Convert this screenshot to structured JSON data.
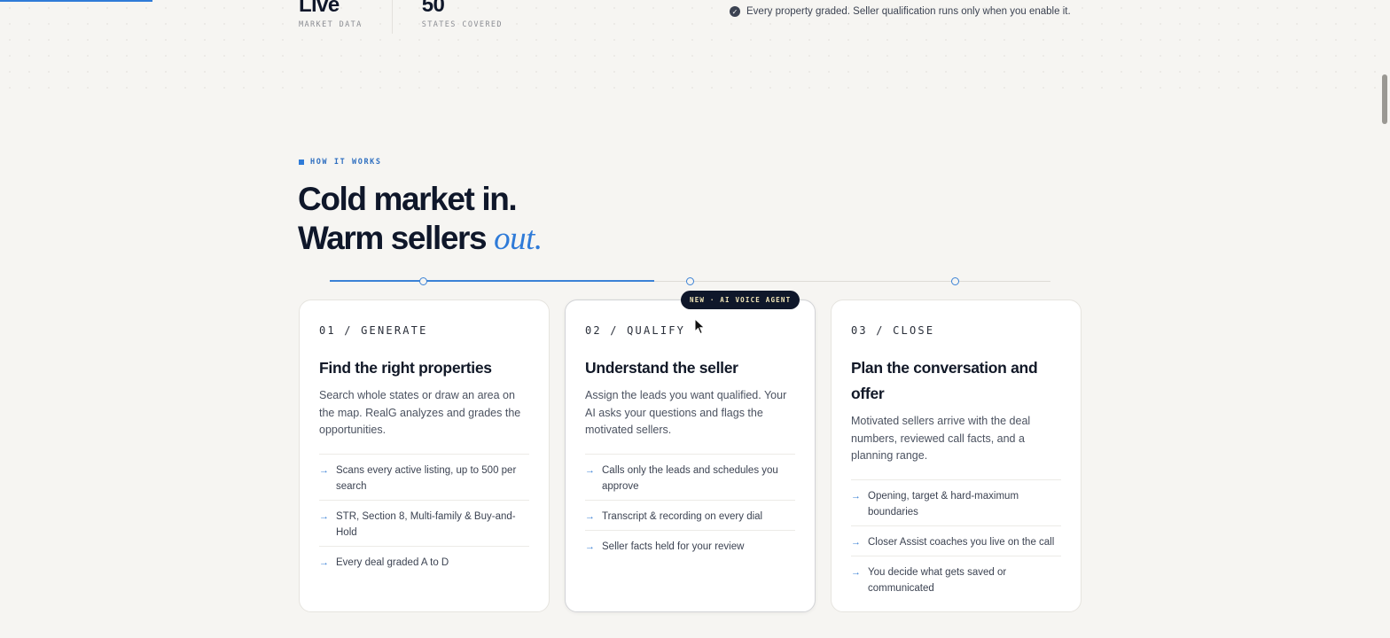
{
  "stats": [
    {
      "value": "Live",
      "label": "MARKET DATA"
    },
    {
      "value": "50",
      "label": "STATES COVERED"
    }
  ],
  "note": "Every property graded. Seller qualification runs only when you enable it.",
  "section": {
    "eyebrow": "HOW IT WORKS",
    "heading_line1": "Cold market in.",
    "heading_line2": "Warm sellers ",
    "heading_accent": "out."
  },
  "timeline": {
    "progress": 0.45
  },
  "badge": "NEW · AI VOICE AGENT",
  "cards": [
    {
      "step": "01 / GENERATE",
      "title": "Find the right properties",
      "description": "Search whole states or draw an area on the map. RealG analyzes and grades the opportunities.",
      "features": [
        "Scans every active listing, up to 500 per search",
        "STR, Section 8, Multi-family & Buy-and-Hold",
        "Every deal graded A to D"
      ]
    },
    {
      "step": "02 / QUALIFY",
      "title": "Understand the seller",
      "description": "Assign the leads you want qualified. Your AI asks your questions and flags the motivated sellers.",
      "features": [
        "Calls only the leads and schedules you approve",
        "Transcript & recording on every dial",
        "Seller facts held for your review"
      ]
    },
    {
      "step": "03 / CLOSE",
      "title": "Plan the conversation and offer",
      "description": "Motivated sellers arrive with the deal numbers, reviewed call facts, and a planning range.",
      "features": [
        "Opening, target & hard-maximum boundaries",
        "Closer Assist coaches you live on the call",
        "You decide what gets saved or communicated"
      ]
    }
  ],
  "colors": {
    "accent": "#2f7bd8",
    "ink": "#0f172a",
    "background": "#f6f5f2"
  },
  "icons": {
    "note": "check-circle-icon",
    "feature": "arrow-right-icon",
    "cursor": "mouse-pointer-icon"
  }
}
